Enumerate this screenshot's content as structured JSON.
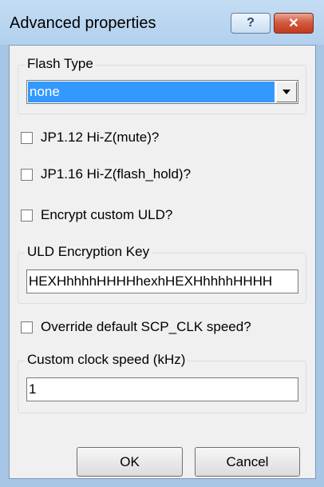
{
  "window": {
    "title": "Advanced properties",
    "help_label": "?",
    "close_label": "✕"
  },
  "flash_type": {
    "label": "Flash Type",
    "selected": "none"
  },
  "checkboxes": {
    "jp112": "JP1.12 Hi-Z(mute)?",
    "jp116": "JP1.16 Hi-Z(flash_hold)?",
    "encrypt": "Encrypt custom ULD?",
    "override": "Override default SCP_CLK speed?"
  },
  "uld_key": {
    "label": "ULD Encryption Key",
    "value": "HEXHhhhhHHHHhexhHEXHhhhhHHHH"
  },
  "clock": {
    "label": "Custom clock speed (kHz)",
    "value": "1"
  },
  "buttons": {
    "ok": "OK",
    "cancel": "Cancel"
  }
}
